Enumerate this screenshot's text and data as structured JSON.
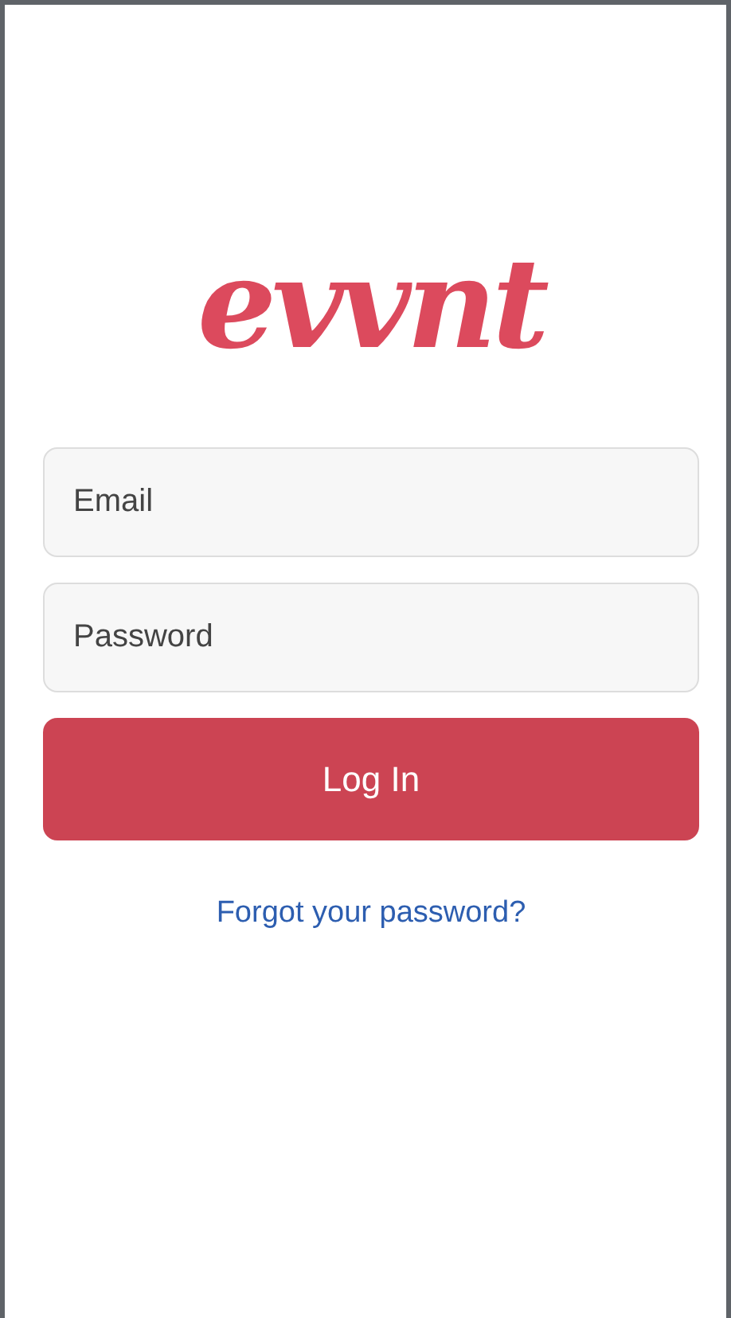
{
  "logo": {
    "text": "evvnt"
  },
  "fields": [
    {
      "placeholder": "Email"
    },
    {
      "placeholder": "Password"
    }
  ],
  "login_button": {
    "label": "Log In"
  },
  "forgot_link": {
    "label": "Forgot your password?"
  }
}
